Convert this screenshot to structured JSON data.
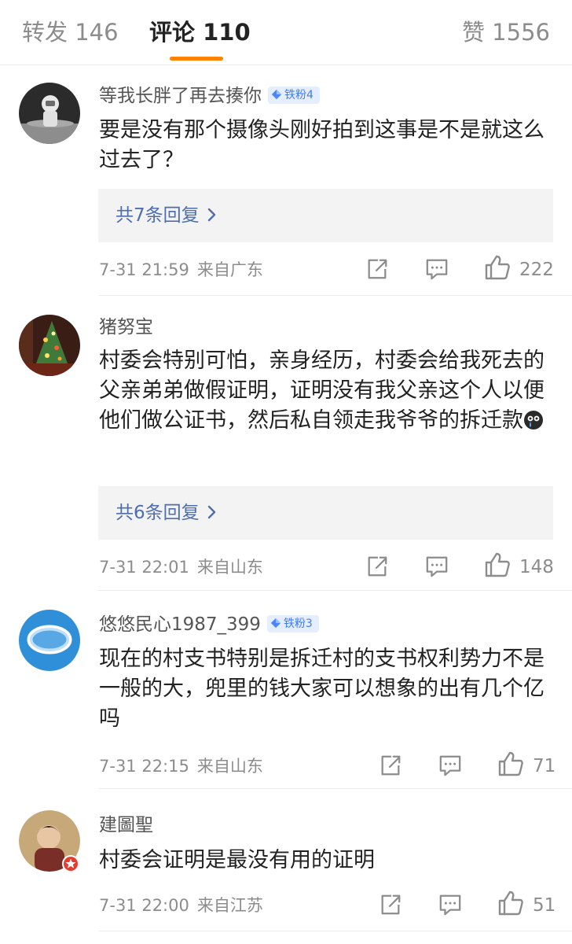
{
  "tabs": {
    "reposts": "转发 146",
    "comments": "评论 110",
    "likes": "赞 1556"
  },
  "accent_color": "#ff8200",
  "comments": [
    {
      "user": "等我长胖了再去揍你",
      "badge": "铁粉4",
      "text": "要是没有那个摄像头刚好拍到这事是不是就这么过去了？",
      "replies": "共7条回复",
      "time": "7-31 21:59",
      "source": "来自广东",
      "likes": "222"
    },
    {
      "user": "猪努宝",
      "text": "村委会特别可怕，亲身经历，村委会给我死去的父亲弟弟做假证明，证明没有我父亲这个人以便他们做公证书，然后私自领走我爷爷的拆迁款",
      "emoji": "crying-face-emoji",
      "replies": "共6条回复",
      "time": "7-31 22:01",
      "source": "来自山东",
      "likes": "148"
    },
    {
      "user": "悠悠民心1987_399",
      "badge": "铁粉3",
      "text": "现在的村支书特别是拆迁村的支书权利势力不是一般的大，兜里的钱大家可以想象的出有几个亿吗",
      "time": "7-31 22:15",
      "source": "来自山东",
      "likes": "71"
    },
    {
      "user": "建圖聖",
      "text": "村委会证明是最没有用的证明",
      "time": "7-31 22:00",
      "source": "来自江苏",
      "likes": "51"
    }
  ],
  "icons": {
    "share": "share-icon",
    "comment": "comment-icon",
    "like": "thumbs-up-icon",
    "badge": "diamond-icon",
    "chevron": "chevron-right-icon"
  }
}
